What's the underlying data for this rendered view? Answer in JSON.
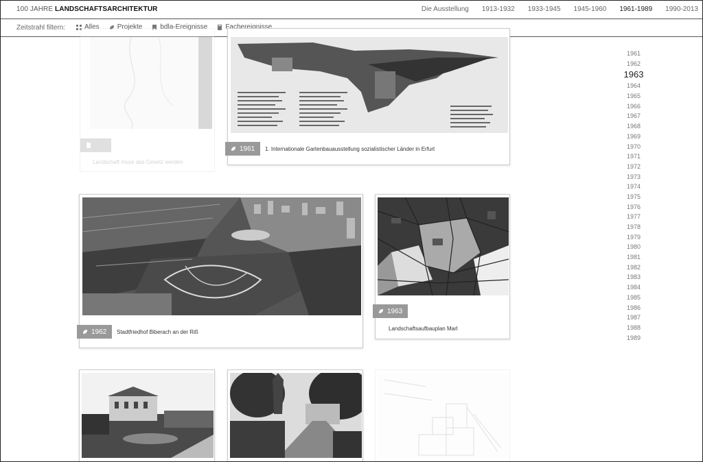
{
  "header": {
    "brand_prefix": "100 JAHRE",
    "brand_bold": "LANDSCHAFTSARCHITEKTUR",
    "nav": [
      "Die Ausstellung",
      "1913-1932",
      "1933-1945",
      "1945-1960",
      "1961-1989",
      "1990-2013"
    ]
  },
  "filterbar": {
    "label": "Zeitstrahl filtern:",
    "filters": [
      "Alles",
      "Projekte",
      "bdla-Ereignisse",
      "Fachereignisse"
    ]
  },
  "timeline": {
    "years": [
      "1961",
      "1962",
      "1963",
      "1964",
      "1965",
      "1966",
      "1967",
      "1968",
      "1969",
      "1970",
      "1971",
      "1972",
      "1973",
      "1974",
      "1975",
      "1976",
      "1977",
      "1978",
      "1979",
      "1980",
      "1981",
      "1982",
      "1983",
      "1984",
      "1985",
      "1986",
      "1987",
      "1988",
      "1989"
    ],
    "current": "1963"
  },
  "cards": {
    "faded_top": {
      "caption": "Landschaft muss das Gesetz werden"
    },
    "erfurt": {
      "year": "1961",
      "caption": "1. Internationale Gartenbauausstellung sozialistischer Länder in Erfurt"
    },
    "biberach": {
      "year": "1962",
      "caption": "Stadtfriedhof Biberach an der Riß"
    },
    "marl": {
      "year": "1963",
      "caption": "Landschaftsaufbauplan Marl"
    }
  }
}
